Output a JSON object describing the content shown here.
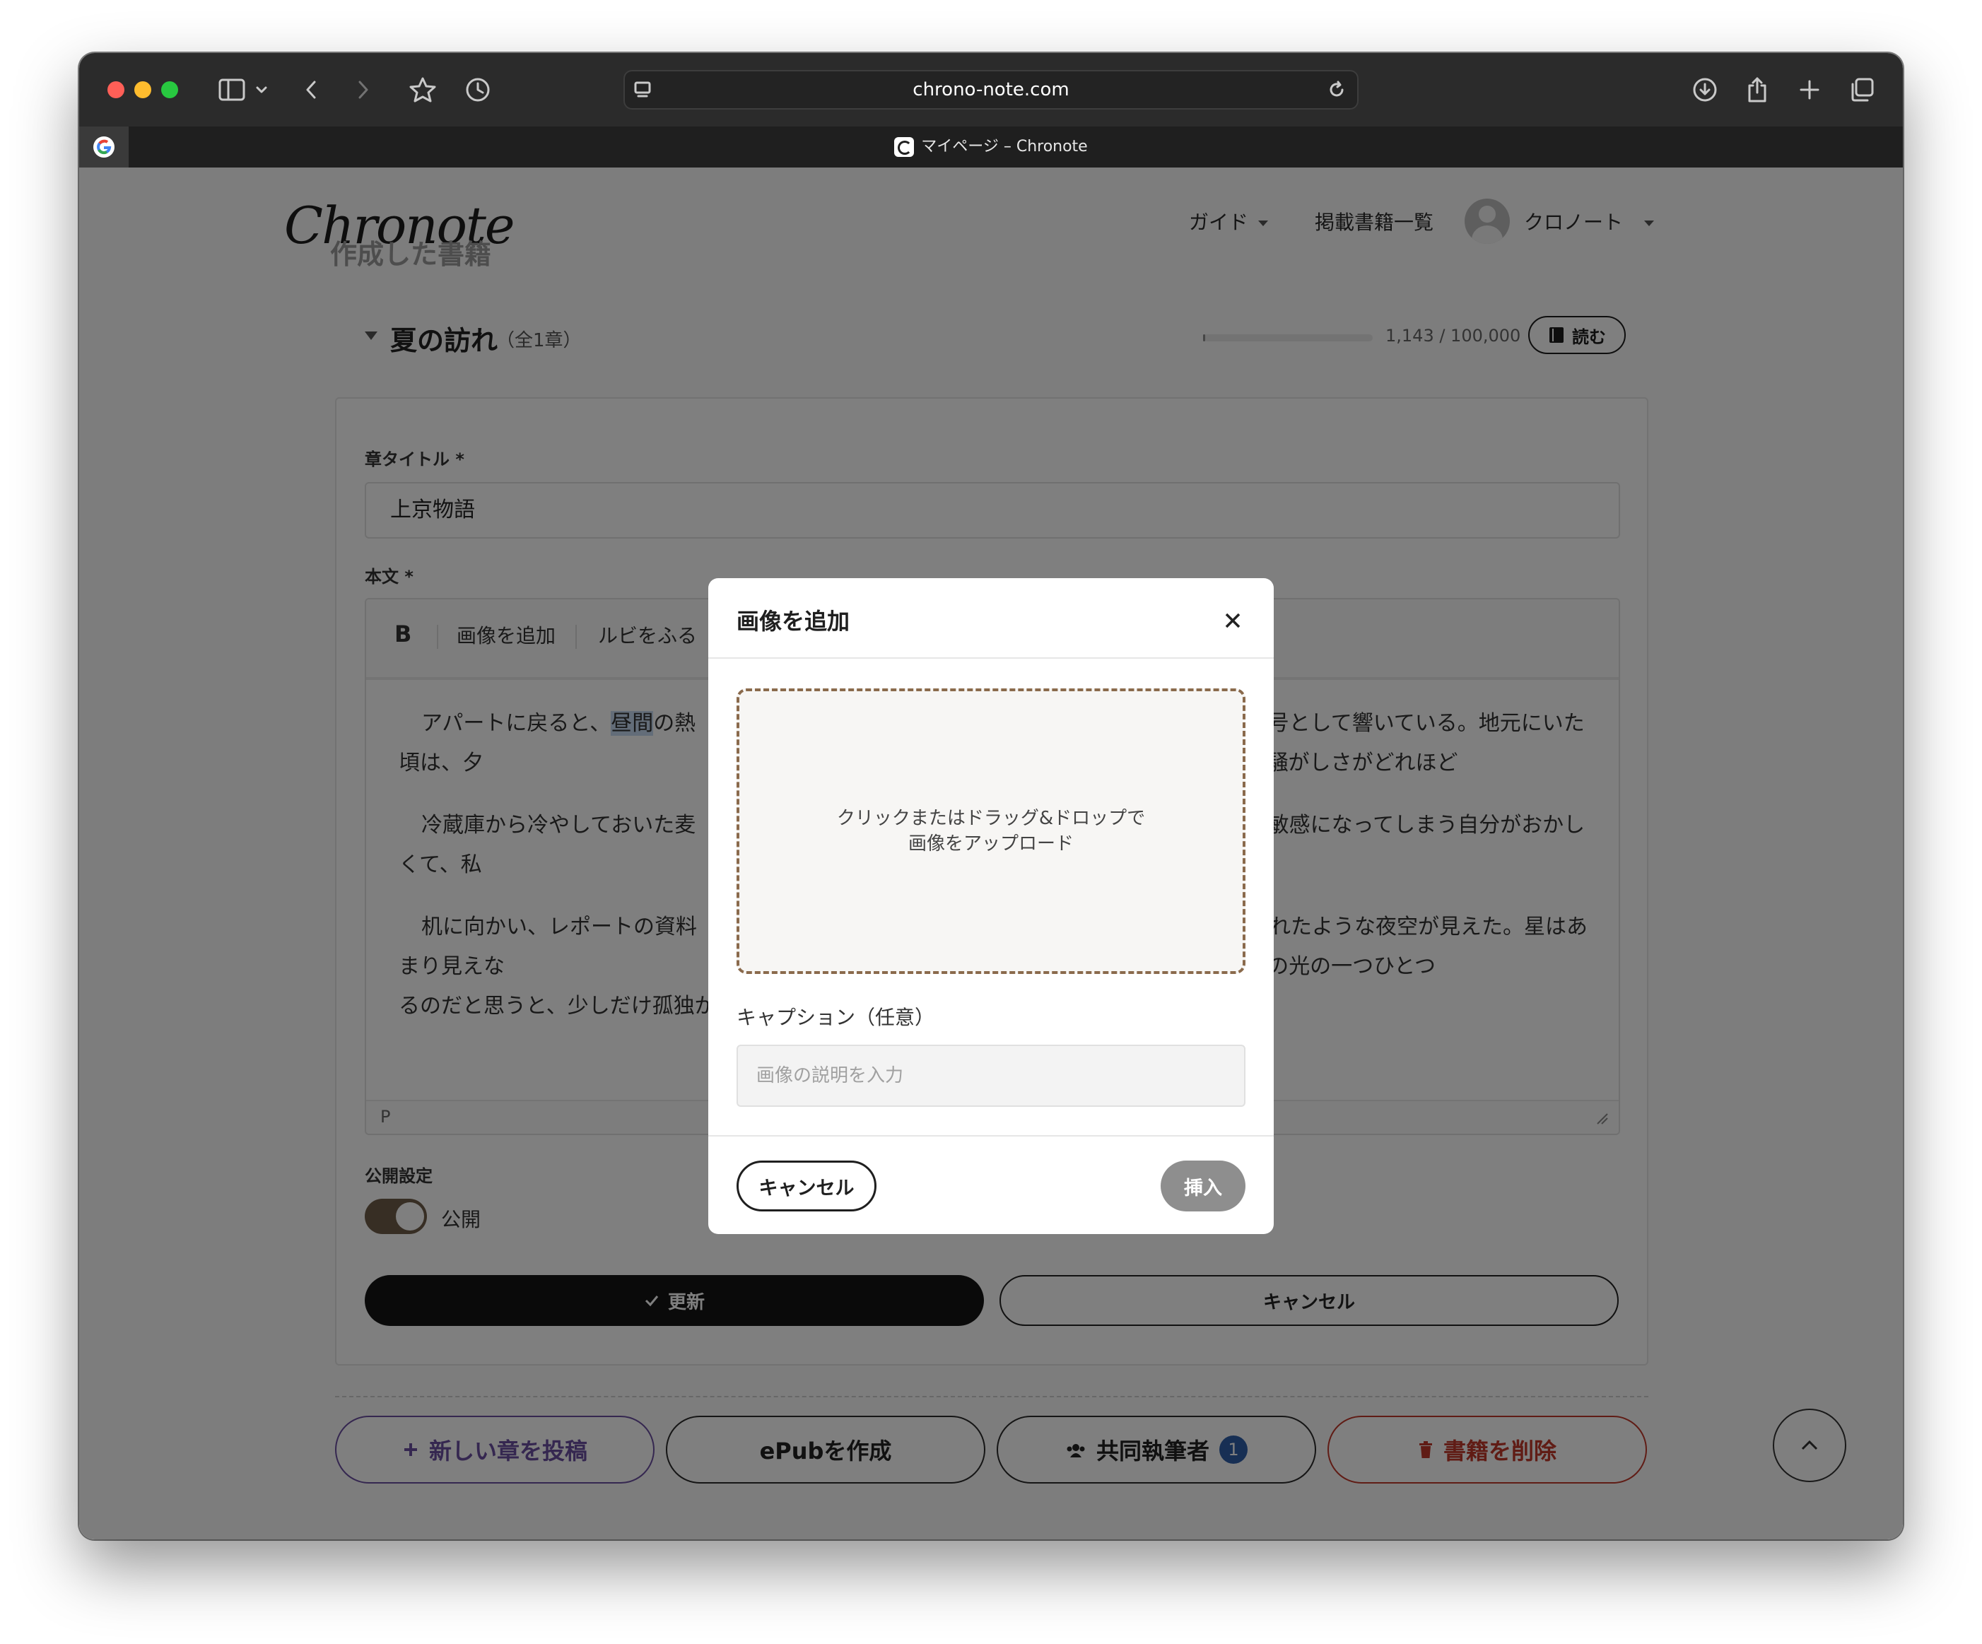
{
  "browser": {
    "url": "chrono-note.com",
    "tab_title": "マイページ – Chronote"
  },
  "header": {
    "logo": "Chronote",
    "section_title": "作成した書籍",
    "nav": [
      {
        "label": "ガイド"
      },
      {
        "label": "掲載書籍一覧"
      }
    ],
    "user_name": "クロノート"
  },
  "book": {
    "title": "夏の訪れ",
    "chapter_count": "（全1章）",
    "char_progress": 0.01143,
    "char_count": "1,143 / 100,000",
    "read_label": "読む"
  },
  "form": {
    "chapter_title_label": "章タイトル *",
    "chapter_title_value": "上京物語",
    "body_label": "本文 *",
    "editor_toolbar": {
      "bold": "B",
      "add_image": "画像を追加",
      "ruby": "ルビをふる"
    },
    "body_paragraphs": [
      {
        "before": "アパートに戻ると、",
        "highlight": "昼間",
        "after": "の熱　　　　　　　　　　　　　　　　　　　だけが、生活の記号として響いている。地元にいた頃は、夕　　　　　　　　　　　　　　　　　　　とさえ思っていたのに。今の私は、その騒がしさがどれほど"
      },
      {
        "before": "",
        "highlight": "",
        "after": "冷蔵庫から冷やしておいた麦　　　　　　　　　　　　　　　　　　　の小さな音にさえ敏感になってしまう自分がおかしくて、私"
      },
      {
        "before": "",
        "highlight": "",
        "after": "机に向かい、レポートの資料　　　　　　　　　　　　　　　　　　　隙間から切り取られたような夜空が見えた。星はあまり見えな　　　　　　　　　　　　　　　　　　いている。眠らない街、東京。その無数の光の一つひとつ　　　　　　　　　　　　　　　　　　るのだと思うと、少しだけ孤独が和らぐ気がした。"
      }
    ],
    "editor_status": "P",
    "visibility_label": "公開設定",
    "visibility_toggle": "公開",
    "update_label": "更新",
    "cancel_label": "キャンセル"
  },
  "actions": {
    "new_chapter": "新しい章を投稿",
    "epub": "ePubを作成",
    "coauthors": "共同執筆者",
    "coauthor_count": "1",
    "delete_book": "書籍を削除"
  },
  "modal": {
    "title": "画像を追加",
    "dropzone_line1": "クリックまたはドラッグ&ドロップで",
    "dropzone_line2": "画像をアップロード",
    "caption_label": "キャプション（任意）",
    "caption_placeholder": "画像の説明を入力",
    "cancel_label": "キャンセル",
    "insert_label": "挿入"
  },
  "colors": {
    "accent_brown": "#8a6a4c",
    "new_chapter_purple": "#6b4fa0",
    "delete_red": "#c0392b",
    "badge_blue": "#2f5ea8"
  }
}
